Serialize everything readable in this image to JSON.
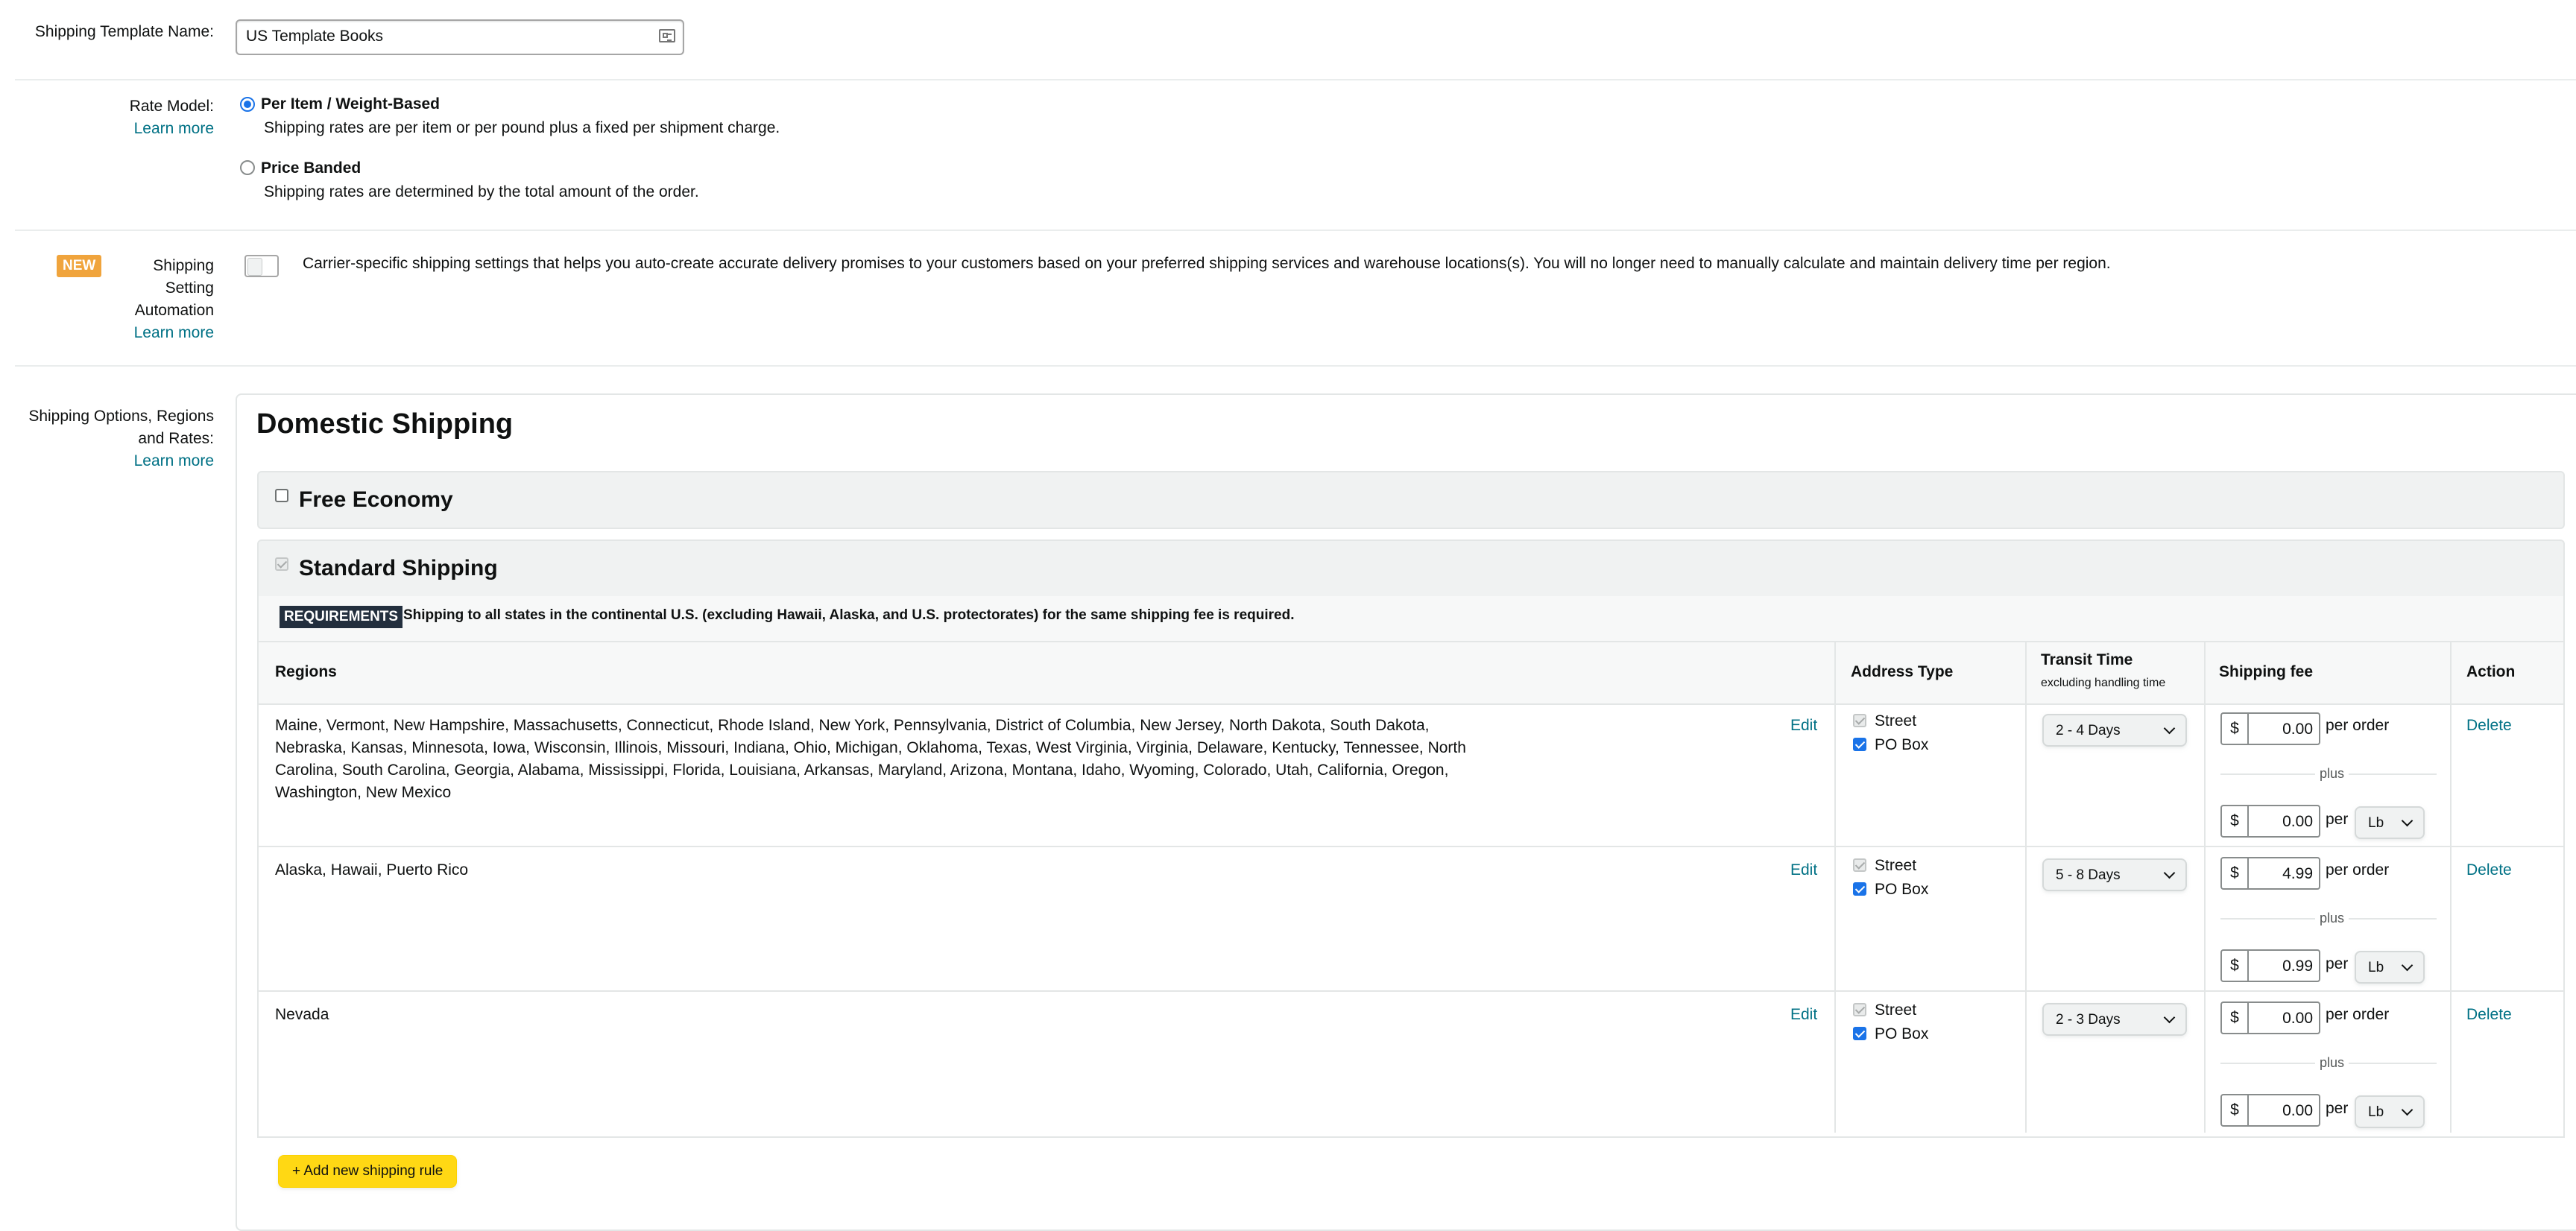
{
  "template_name": {
    "label": "Shipping Template Name:",
    "value": "US Template Books"
  },
  "rate_model": {
    "label": "Rate Model:",
    "learn_more": "Learn more",
    "options": [
      {
        "title": "Per Item / Weight-Based",
        "description": "Shipping rates are per item or per pound plus a fixed per shipment charge.",
        "selected": true
      },
      {
        "title": "Price Banded",
        "description": "Shipping rates are determined by the total amount of the order.",
        "selected": false
      }
    ]
  },
  "automation": {
    "badge": "NEW",
    "label_line1": "Shipping",
    "label_line2": "Setting",
    "label_line3": "Automation",
    "learn_more": "Learn more",
    "description": "Carrier-specific shipping settings that helps you auto-create accurate delivery promises to your customers based on your preferred shipping services and warehouse locations(s). You will no longer need to manually calculate and maintain delivery time per region."
  },
  "options_section": {
    "label_line1": "Shipping Options, Regions",
    "label_line2": "and Rates:",
    "learn_more": "Learn more"
  },
  "domestic": {
    "title": "Domestic Shipping",
    "free_economy": "Free Economy",
    "standard": "Standard Shipping",
    "requirements_badge": "REQUIREMENTS",
    "requirements_text": "Shipping to all states in the continental U.S. (excluding Hawaii, Alaska, and U.S. protectorates) for the same shipping fee is required.",
    "columns": {
      "regions": "Regions",
      "address_type": "Address Type",
      "transit_time": "Transit Time",
      "transit_sub": "excluding handling time",
      "shipping_fee": "Shipping fee",
      "action": "Action"
    },
    "rows": [
      {
        "regions_line1": "Maine, Vermont, New Hampshire, Massachusetts, Connecticut, Rhode Island, New York, Pennsylvania, District of Columbia, New Jersey, North Dakota, South Dakota,",
        "regions_line2": "Nebraska, Kansas, Minnesota, Iowa, Wisconsin, Illinois, Missouri, Indiana, Ohio, Michigan, Oklahoma, Texas, West Virginia, Virginia, Delaware, Kentucky, Tennessee, North",
        "regions_line3": "Carolina, South Carolina, Georgia, Alabama, Mississippi, Florida, Louisiana, Arkansas, Maryland, Arizona, Montana, Idaho, Wyoming, Colorado, Utah, California, Oregon,",
        "regions_line4": "Washington, New Mexico",
        "edit": "Edit",
        "street": "Street",
        "po_box": "PO Box",
        "transit": "2 - 4 Days",
        "currency": "$",
        "per_order_amount": "0.00",
        "per_order_label": "per order",
        "plus": "plus",
        "per_unit_amount": "0.00",
        "per_label": "per",
        "unit": "Lb",
        "delete": "Delete"
      },
      {
        "regions_line1": "Alaska, Hawaii, Puerto Rico",
        "edit": "Edit",
        "street": "Street",
        "po_box": "PO Box",
        "transit": "5 - 8 Days",
        "currency": "$",
        "per_order_amount": "4.99",
        "per_order_label": "per order",
        "plus": "plus",
        "per_unit_amount": "0.99",
        "per_label": "per",
        "unit": "Lb",
        "delete": "Delete"
      },
      {
        "regions_line1": "Nevada",
        "edit": "Edit",
        "street": "Street",
        "po_box": "PO Box",
        "transit": "2 - 3 Days",
        "currency": "$",
        "per_order_amount": "0.00",
        "per_order_label": "per order",
        "plus": "plus",
        "per_unit_amount": "0.00",
        "per_label": "per",
        "unit": "Lb",
        "delete": "Delete"
      }
    ],
    "add_rule": "+ Add new shipping rule"
  },
  "colors": {
    "link": "#007185",
    "button": "#ffd814",
    "badge_new": "#f0a43c",
    "requirements_badge": "#232f3e"
  }
}
